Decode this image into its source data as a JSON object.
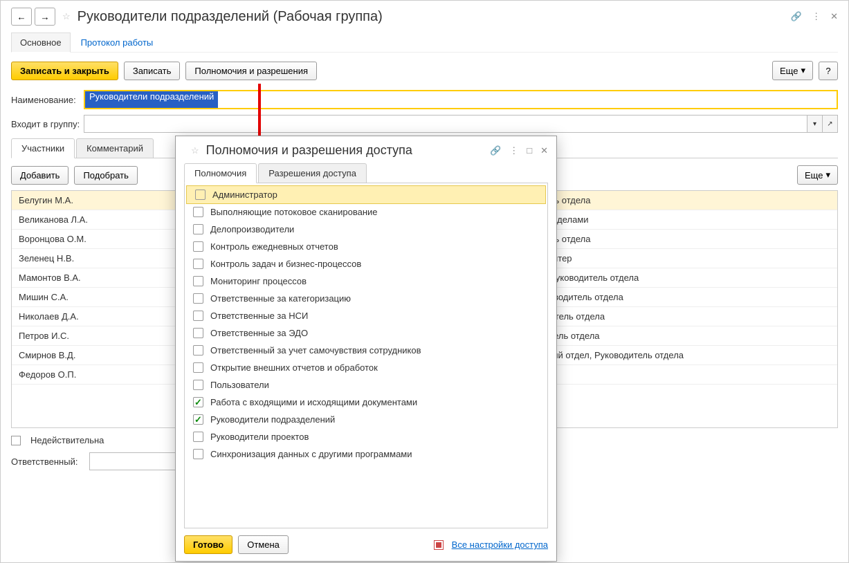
{
  "header": {
    "title": "Руководители подразделений (Рабочая группа)"
  },
  "navtabs": {
    "main": "Основное",
    "protocol": "Протокол работы"
  },
  "toolbar": {
    "save_close": "Записать и закрыть",
    "save": "Записать",
    "permissions": "Полномочия и разрешения",
    "more": "Еще",
    "help": "?"
  },
  "form": {
    "name_label": "Наименование:",
    "name_value": "Руководители подразделений",
    "group_label": "Входит в группу:",
    "group_value": ""
  },
  "inner_tabs": {
    "participants": "Участники",
    "comment": "Комментарий"
  },
  "subtoolbar": {
    "add": "Добавить",
    "pick": "Подобрать",
    "more": "Еще"
  },
  "grid": [
    {
      "name": "Белугин М.А.",
      "role": "ель отдела"
    },
    {
      "name": "Великанова Л.А.",
      "role": "ий делами"
    },
    {
      "name": "Воронцова О.М.",
      "role": "ель отдела"
    },
    {
      "name": "Зеленец Н.В.",
      "role": "галтер"
    },
    {
      "name": "Мамонтов В.А.",
      "role": ", Руководитель отдела"
    },
    {
      "name": "Мишин С.А.",
      "role": "ководитель отдела"
    },
    {
      "name": "Николаев Д.А.",
      "role": "дитель отдела"
    },
    {
      "name": "Петров И.С.",
      "role": "итель отдела"
    },
    {
      "name": "Смирнов В.Д.",
      "role": "ский отдел, Руководитель отдела"
    },
    {
      "name": "Федоров О.П.",
      "role": ""
    }
  ],
  "footer": {
    "inactive": "Недействительна",
    "responsible": "Ответственный:"
  },
  "dialog": {
    "title": "Полномочия и разрешения доступа",
    "tabs": {
      "perm": "Полномочия",
      "access": "Разрешения доступа"
    },
    "items": [
      {
        "label": "Администратор",
        "checked": false,
        "selected": true
      },
      {
        "label": "Выполняющие потоковое сканирование",
        "checked": false
      },
      {
        "label": "Делопроизводители",
        "checked": false
      },
      {
        "label": "Контроль ежедневных отчетов",
        "checked": false
      },
      {
        "label": "Контроль задач и бизнес-процессов",
        "checked": false
      },
      {
        "label": "Мониторинг процессов",
        "checked": false
      },
      {
        "label": "Ответственные за категоризацию",
        "checked": false
      },
      {
        "label": "Ответственные за НСИ",
        "checked": false
      },
      {
        "label": "Ответственные за ЭДО",
        "checked": false
      },
      {
        "label": "Ответственный за учет самочувствия сотрудников",
        "checked": false
      },
      {
        "label": "Открытие внешних отчетов и обработок",
        "checked": false
      },
      {
        "label": "Пользователи",
        "checked": false
      },
      {
        "label": "Работа с входящими и исходящими документами",
        "checked": true
      },
      {
        "label": "Руководители подразделений",
        "checked": true
      },
      {
        "label": "Руководители проектов",
        "checked": false
      },
      {
        "label": "Синхронизация данных с другими программами",
        "checked": false
      }
    ],
    "footer": {
      "done": "Готово",
      "cancel": "Отмена",
      "all_settings": "Все настройки доступа"
    }
  }
}
